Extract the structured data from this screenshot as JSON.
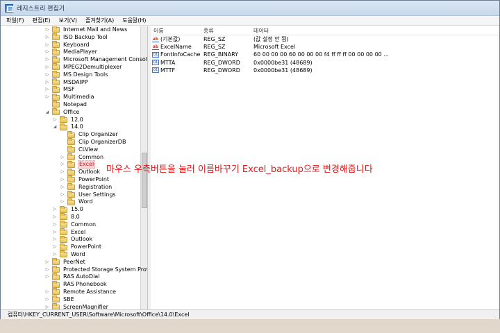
{
  "window": {
    "title": "레지스트리 편집기"
  },
  "menu": [
    "파일(F)",
    "편집(E)",
    "보기(V)",
    "즐겨찾기(A)",
    "도움말(H)"
  ],
  "tree": [
    {
      "label": "Internet Mail and News",
      "level": 0,
      "arrow": "▷"
    },
    {
      "label": "ISO Backup Tool",
      "level": 0,
      "arrow": "▷"
    },
    {
      "label": "Keyboard",
      "level": 0,
      "arrow": "▷"
    },
    {
      "label": "MediaPlayer",
      "level": 0,
      "arrow": "▷"
    },
    {
      "label": "Microsoft Management Console",
      "level": 0,
      "arrow": "▷"
    },
    {
      "label": "MPEG2Demultiplexer",
      "level": 0,
      "arrow": "▷"
    },
    {
      "label": "MS Design Tools",
      "level": 0,
      "arrow": "▷"
    },
    {
      "label": "MSDAIPP",
      "level": 0,
      "arrow": "▷"
    },
    {
      "label": "MSF",
      "level": 0,
      "arrow": "▷"
    },
    {
      "label": "Multimedia",
      "level": 0,
      "arrow": "▷"
    },
    {
      "label": "Notepad",
      "level": 0,
      "arrow": ""
    },
    {
      "label": "Office",
      "level": 0,
      "arrow": "◢"
    },
    {
      "label": "12.0",
      "level": 1,
      "arrow": "▷"
    },
    {
      "label": "14.0",
      "level": 1,
      "arrow": "◢"
    },
    {
      "label": "Clip Organizer",
      "level": 2,
      "arrow": ""
    },
    {
      "label": "Clip OrganizerDB",
      "level": 2,
      "arrow": ""
    },
    {
      "label": "CLView",
      "level": 2,
      "arrow": ""
    },
    {
      "label": "Common",
      "level": 2,
      "arrow": "▷"
    },
    {
      "label": "Excel",
      "level": 2,
      "arrow": "▷",
      "selected": true
    },
    {
      "label": "Outlook",
      "level": 2,
      "arrow": "▷"
    },
    {
      "label": "PowerPoint",
      "level": 2,
      "arrow": "▷"
    },
    {
      "label": "Registration",
      "level": 2,
      "arrow": "▷"
    },
    {
      "label": "User Settings",
      "level": 2,
      "arrow": "▷"
    },
    {
      "label": "Word",
      "level": 2,
      "arrow": "▷"
    },
    {
      "label": "15.0",
      "level": 1,
      "arrow": "▷"
    },
    {
      "label": "8.0",
      "level": 1,
      "arrow": "▷"
    },
    {
      "label": "Common",
      "level": 1,
      "arrow": "▷"
    },
    {
      "label": "Excel",
      "level": 1,
      "arrow": "▷"
    },
    {
      "label": "Outlook",
      "level": 1,
      "arrow": "▷"
    },
    {
      "label": "PowerPoint",
      "level": 1,
      "arrow": "▷"
    },
    {
      "label": "Word",
      "level": 1,
      "arrow": "▷"
    },
    {
      "label": "PeerNet",
      "level": 0,
      "arrow": "▷"
    },
    {
      "label": "Protected Storage System Provider",
      "level": 0,
      "arrow": "▷"
    },
    {
      "label": "RAS AutoDial",
      "level": 0,
      "arrow": "▷"
    },
    {
      "label": "RAS Phonebook",
      "level": 0,
      "arrow": ""
    },
    {
      "label": "Remote Assistance",
      "level": 0,
      "arrow": "▷"
    },
    {
      "label": "SBE",
      "level": 0,
      "arrow": "▷"
    },
    {
      "label": "ScreenMagnifier",
      "level": 0,
      "arrow": "▷"
    }
  ],
  "values": {
    "headers": {
      "name": "이름",
      "type": "종류",
      "data": "데이터"
    },
    "rows": [
      {
        "icon": "string-value-icon",
        "name": "(기본값)",
        "type": "REG_SZ",
        "data": "(값 설정 안 됨)"
      },
      {
        "icon": "string-value-icon",
        "name": "ExcelName",
        "type": "REG_SZ",
        "data": "Microsoft Excel"
      },
      {
        "icon": "binary-value-icon",
        "name": "FontInfoCache",
        "type": "REG_BINARY",
        "data": "60 00 00 00 60 00 00 00 f4 ff ff ff 00 00 00 00 ..."
      },
      {
        "icon": "binary-value-icon",
        "name": "MTTA",
        "type": "REG_DWORD",
        "data": "0x0000be31 (48689)"
      },
      {
        "icon": "binary-value-icon",
        "name": "MTTF",
        "type": "REG_DWORD",
        "data": "0x0000be31 (48689)"
      }
    ]
  },
  "annotation": "마우스 우측버튼을 눌러 이름바꾸기  Excel_backup으로 변경해줍니다",
  "status": "컴퓨터\\HKEY_CURRENT_USER\\Software\\Microsoft\\Office\\14.0\\Excel"
}
